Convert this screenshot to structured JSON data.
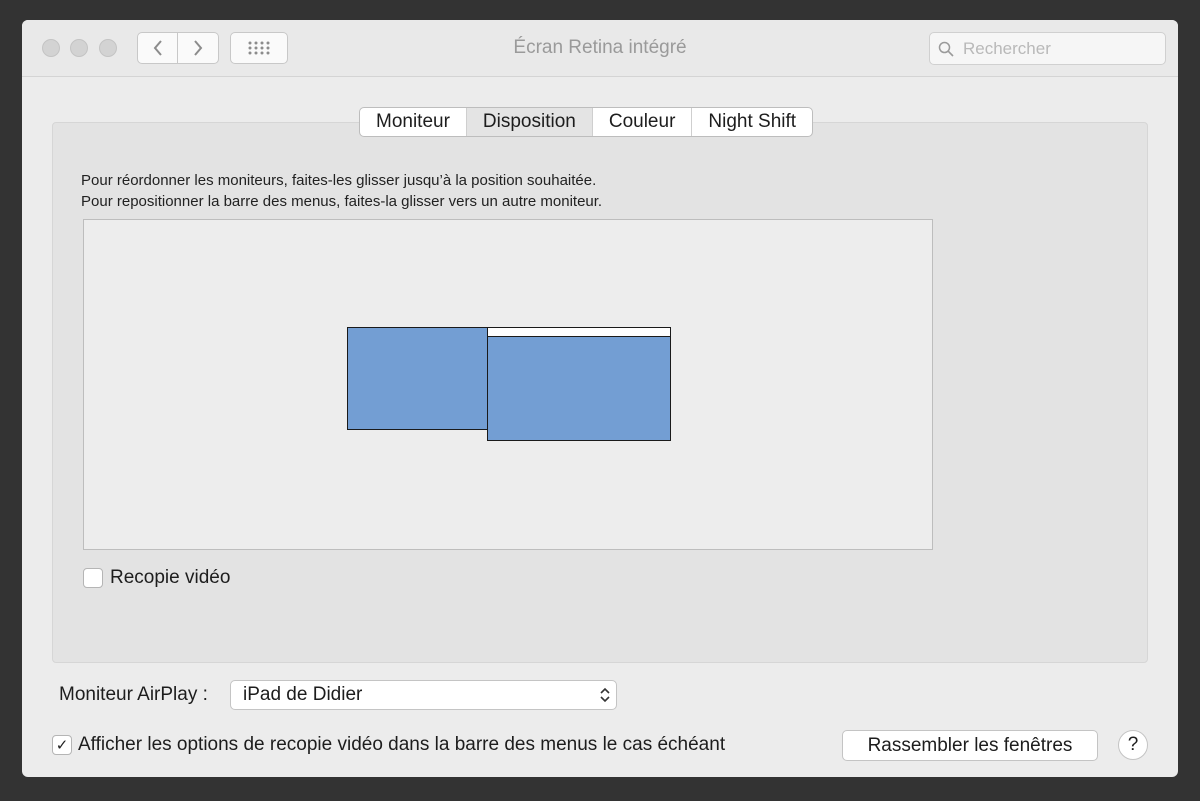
{
  "window": {
    "title": "Écran Retina intégré"
  },
  "toolbar": {
    "back_icon": "chevron-left-icon",
    "forward_icon": "chevron-right-icon",
    "grid_icon": "grid-icon"
  },
  "search": {
    "placeholder": "Rechercher",
    "value": "",
    "icon": "search-icon"
  },
  "tabs": [
    {
      "label": "Moniteur",
      "selected": false
    },
    {
      "label": "Disposition",
      "selected": true
    },
    {
      "label": "Couleur",
      "selected": false
    },
    {
      "label": "Night Shift",
      "selected": false
    }
  ],
  "arrangement": {
    "instruction_line1": "Pour réordonner les moniteurs, faites-les glisser jusqu’à la position souhaitée.",
    "instruction_line2": "Pour repositionner la barre des menus, faites-la glisser vers un autre moniteur.",
    "display_color": "#739ed3"
  },
  "mirroring": {
    "label": "Recopie vidéo",
    "checked": false
  },
  "airplay": {
    "label": "Moniteur AirPlay :",
    "value": "iPad de Didier"
  },
  "menubar_option": {
    "label": "Afficher les options de recopie vidéo dans la barre des menus le cas échéant",
    "checked": true,
    "checkmark": "✓"
  },
  "gather_button": {
    "label": "Rassembler les fenêtres"
  },
  "help_button": {
    "label": "?"
  },
  "colors": {
    "background": "#333333",
    "window": "#ececec",
    "display": "#739ed3"
  }
}
